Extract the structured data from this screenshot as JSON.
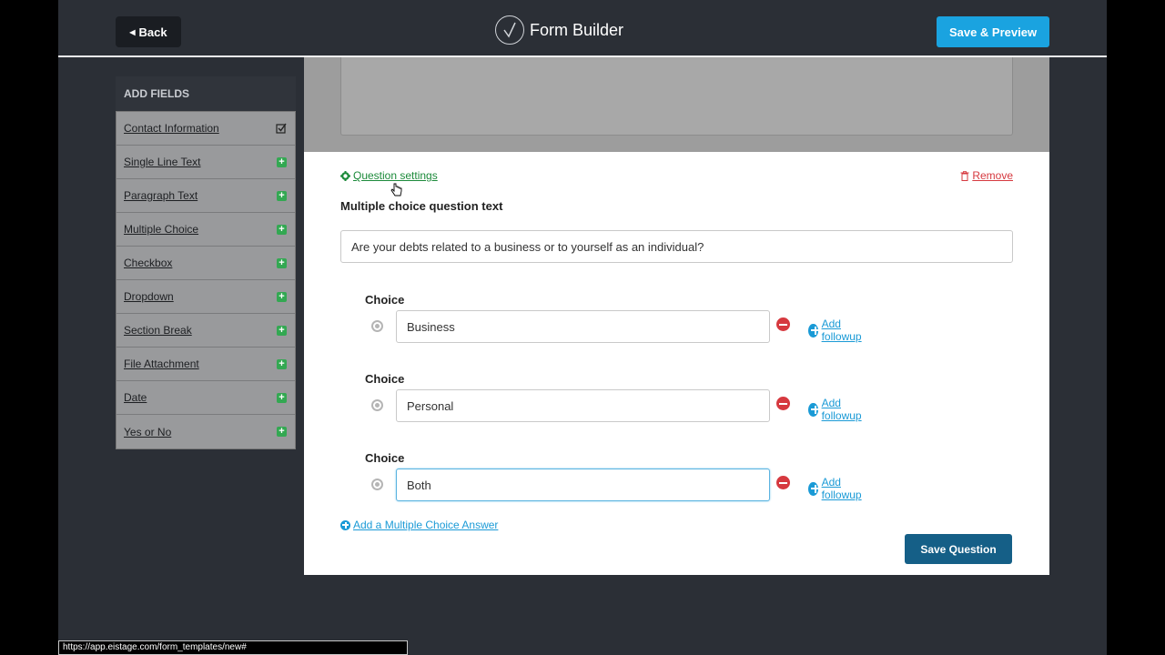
{
  "header": {
    "back_label": "Back",
    "title": "Form Builder",
    "save_preview_label": "Save & Preview"
  },
  "sidebar": {
    "heading": "ADD FIELDS",
    "items": [
      {
        "label": "Contact Information",
        "icon": "check-square-icon"
      },
      {
        "label": "Single Line Text",
        "icon": "plus-icon"
      },
      {
        "label": "Paragraph Text",
        "icon": "plus-icon"
      },
      {
        "label": "Multiple Choice",
        "icon": "plus-icon"
      },
      {
        "label": "Checkbox",
        "icon": "plus-icon"
      },
      {
        "label": "Dropdown",
        "icon": "plus-icon"
      },
      {
        "label": "Section Break",
        "icon": "plus-icon"
      },
      {
        "label": "File Attachment",
        "icon": "plus-icon"
      },
      {
        "label": "Date",
        "icon": "plus-icon"
      },
      {
        "label": "Yes or No",
        "icon": "plus-icon"
      }
    ]
  },
  "editor": {
    "question_settings_label": "Question settings",
    "remove_label": "Remove",
    "question_label": "Multiple choice question text",
    "question_value": "Are your debts related to a business or to yourself as an individual?",
    "choices": [
      {
        "label": "Choice",
        "value": "Business",
        "followup_label": "Add followup"
      },
      {
        "label": "Choice",
        "value": "Personal",
        "followup_label": "Add followup"
      },
      {
        "label": "Choice",
        "value": "Both",
        "followup_label": "Add followup"
      }
    ],
    "add_answer_label": "Add a Multiple Choice Answer",
    "save_question_label": "Save Question"
  },
  "status_bar": {
    "url": "https://app.eistage.com/form_templates/new#"
  },
  "colors": {
    "primary_blue": "#1aa3e0",
    "save_question": "#155f87",
    "settings_green": "#1c8a3a",
    "remove_red": "#d6393f",
    "link_blue": "#1a9ad6"
  }
}
